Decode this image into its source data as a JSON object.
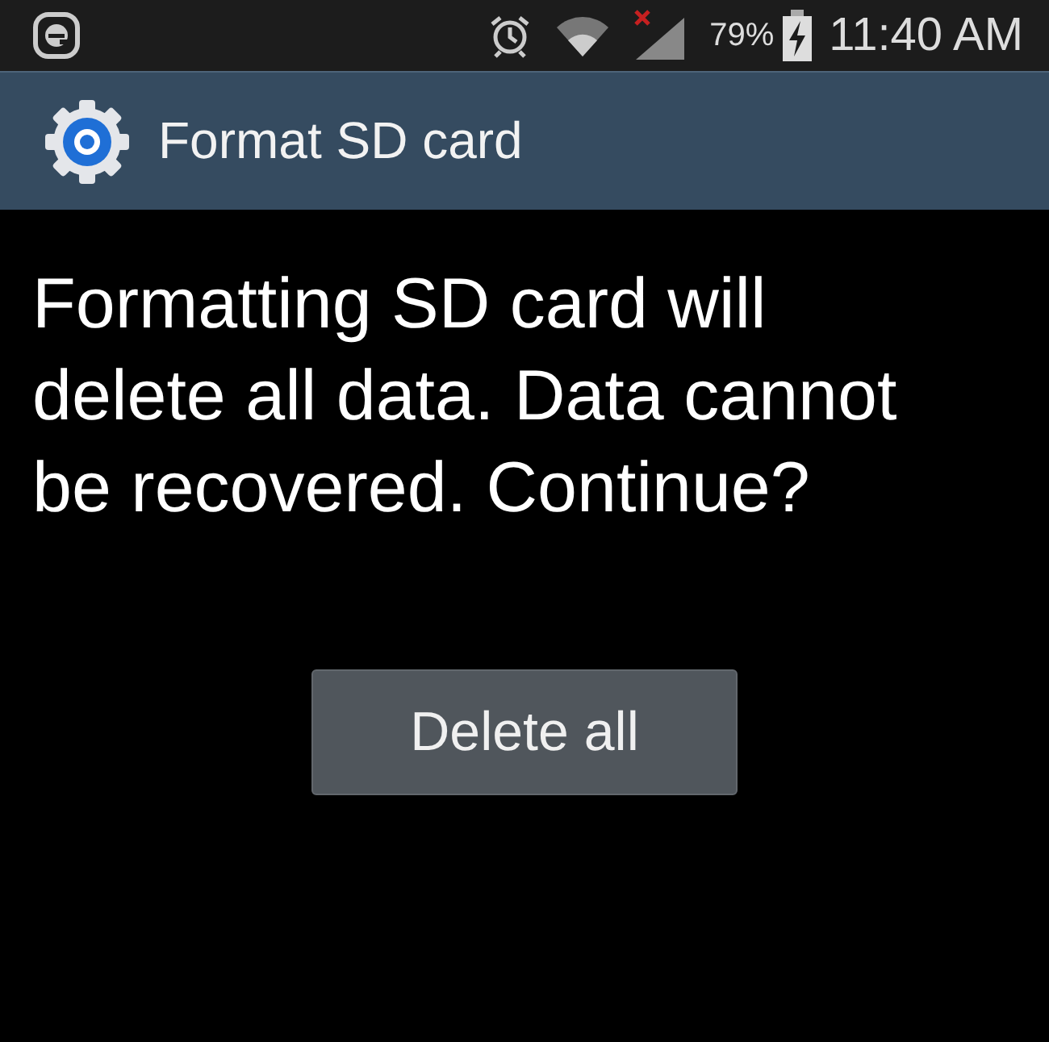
{
  "status_bar": {
    "battery": "79%",
    "time": "11:40 AM"
  },
  "title_bar": {
    "title": "Format SD card"
  },
  "message": "Formatting SD card will delete all data. Data cannot be recovered. Continue?",
  "buttons": [
    "Delete all"
  ]
}
